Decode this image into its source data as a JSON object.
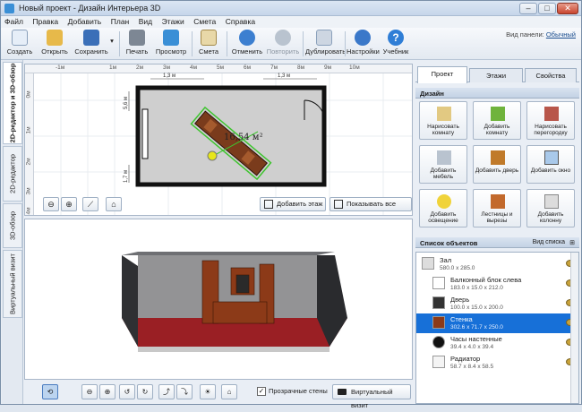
{
  "window": {
    "title": "Новый проект - Дизайн Интерьера 3D"
  },
  "menu": [
    "Файл",
    "Правка",
    "Добавить",
    "План",
    "Вид",
    "Этажи",
    "Смета",
    "Справка"
  ],
  "toolbar": {
    "buttons": [
      {
        "label": "Создать",
        "icon": "new-file-icon",
        "color": "#e6eef8"
      },
      {
        "label": "Открыть",
        "icon": "folder-icon",
        "color": "#e7b94a"
      },
      {
        "label": "Сохранить",
        "icon": "floppy-icon",
        "color": "#3a6fb8"
      },
      {
        "label": "Печать",
        "icon": "printer-icon",
        "color": "#7d8794"
      },
      {
        "label": "Просмотр",
        "icon": "monitor-icon",
        "color": "#3a8fd6"
      },
      {
        "label": "Смета",
        "icon": "estimate-icon",
        "color": "#e8d8a8"
      },
      {
        "label": "Отменить",
        "icon": "undo-icon",
        "color": "#3c7fd0"
      },
      {
        "label": "Повторить",
        "icon": "redo-icon",
        "color": "#b9c3cf"
      },
      {
        "label": "Дублировать",
        "icon": "duplicate-icon",
        "color": "#cdd6e2"
      },
      {
        "label": "Настройки",
        "icon": "gear-icon",
        "color": "#3a78c9"
      },
      {
        "label": "Учебник",
        "icon": "help-icon",
        "color": "#2f7ed6"
      }
    ],
    "panel_view_label": "Вид панели:",
    "panel_view_value": "Обычный"
  },
  "left_tabs": [
    "2D-редактор и 3D-обзор",
    "2D-редактор",
    "3D-обзор",
    "Виртуальный визит"
  ],
  "editor2d": {
    "ruler_top": [
      "-1м",
      "1м",
      "2м",
      "3м",
      "4м",
      "5м",
      "6м",
      "7м",
      "8м",
      "9м",
      "10м"
    ],
    "ruler_left": [
      "0м",
      "1м",
      "2м",
      "3м",
      "4м"
    ],
    "dim_top_left": "1,3 м",
    "dim_top_right": "1,3 м",
    "dim_left_top": "5,6 м",
    "dim_left_bottom": "1,7 м",
    "area_label": "16,54 м²",
    "add_floor_label": "Добавить этаж",
    "show_sizes_label": "Показывать все размеры"
  },
  "bottom": {
    "transparent_walls_label": "Прозрачные стены",
    "transparent_walls_checked": true,
    "virtual_visit_label": "Виртуальный визит"
  },
  "right": {
    "tabs": [
      "Проект",
      "Этажи",
      "Свойства"
    ],
    "design_header": "Дизайн",
    "design_buttons": [
      "Нарисовать комнату",
      "Добавить комнату",
      "Нарисовать перегородку",
      "Добавить мебель",
      "Добавить дверь",
      "Добавить окно",
      "Добавить освещение",
      "Лестницы и вырезы",
      "Добавить колонну"
    ],
    "objects_header": "Список объектов",
    "view_list_label": "Вид списка",
    "objects": [
      {
        "name": "Зал",
        "dims": "580.0 x 285.0"
      },
      {
        "name": "Балконный блок слева",
        "dims": "183.0 x 15.0 x 212.0"
      },
      {
        "name": "Дверь",
        "dims": "100.0 x 15.0 x 200.0"
      },
      {
        "name": "Стенка",
        "dims": "302.6 x 71.7 x 250.0"
      },
      {
        "name": "Часы настенные",
        "dims": "39.4 x 4.0 x 39.4"
      },
      {
        "name": "Радиатор",
        "dims": "58.7 x 8.4 x 58.5"
      }
    ]
  }
}
